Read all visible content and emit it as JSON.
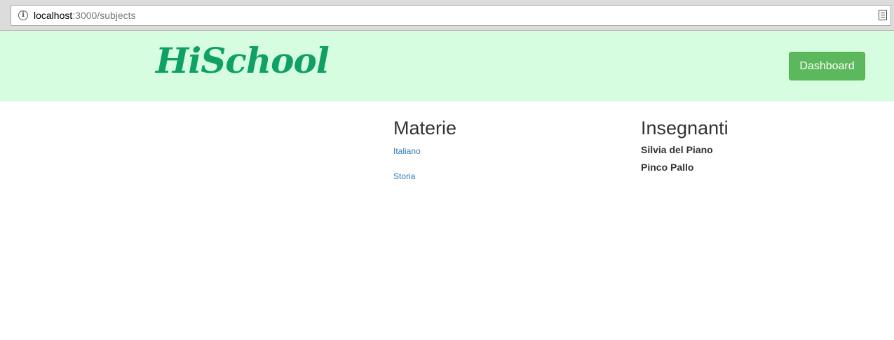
{
  "browser": {
    "url_host": "localhost",
    "url_path": ":3000/subjects",
    "info_icon": "info-circle-icon",
    "reader_icon": "reader-mode-icon"
  },
  "header": {
    "logo_text": "HiSchool",
    "dashboard_label": "Dashboard",
    "background_color": "#d6fde0",
    "logo_color": "#0fa065",
    "button_color": "#5cb85c"
  },
  "subjects": {
    "heading": "Materie",
    "items": [
      "Italiano",
      "Storia"
    ],
    "link_color": "#337ab7"
  },
  "teachers": {
    "heading": "Insegnanti",
    "items": [
      "Silvia del Piano",
      "Pinco Pallo"
    ]
  }
}
